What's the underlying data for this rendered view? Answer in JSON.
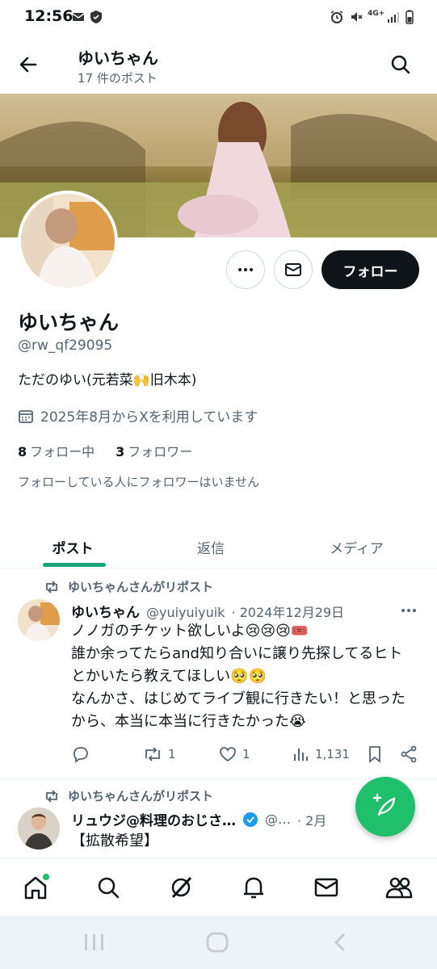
{
  "status_bar": {
    "time": "12:56",
    "network": "4G+",
    "icons": [
      "mail-icon",
      "shield-icon",
      "alarm-icon",
      "mute-icon",
      "signal-icon",
      "battery-icon"
    ]
  },
  "header": {
    "name": "ゆいちゃん",
    "post_count": "17 件のポスト"
  },
  "profile": {
    "name": "ゆいちゃん",
    "handle": "@rw_qf29095",
    "bio": "ただのゆい(元若菜🙌旧木本)",
    "joined": "2025年8月からXを利用しています",
    "following_count": "8",
    "following_label": "フォロー中",
    "followers_count": "3",
    "followers_label": "フォロワー",
    "note": "フォローしている人にフォロワーはいません",
    "follow_button": "フォロー"
  },
  "tabs": [
    {
      "label": "ポスト",
      "active": true
    },
    {
      "label": "返信",
      "active": false
    },
    {
      "label": "メディア",
      "active": false
    }
  ],
  "tweets": [
    {
      "repost_label": "ゆいちゃんさんがリポスト",
      "name": "ゆいちゃん",
      "handle": "@yuiyuiyuik",
      "date": "2024年12月29日",
      "lines": [
        "ノノガのチケット欲しいよ😢😢😢🎟️",
        "誰か余ってたらand知り合いに譲り先探してるヒト",
        "とかいたら教えてほしい🥺🥺",
        "なんかさ、はじめてライブ観に行きたい！と思った",
        "から、本当に本当に行きたかった😭"
      ],
      "reposts": "1",
      "likes": "1",
      "views": "1,131"
    },
    {
      "repost_label": "ゆいちゃんさんがリポスト",
      "name": "リュウジ@料理のおじさ…",
      "handle": "@…",
      "date": "· 2月",
      "first_line": "【拡散希望】"
    }
  ],
  "colors": {
    "accent": "#1aa37a",
    "fab": "#1fbf6b",
    "text_secondary": "#536471",
    "verified": "#1d9bf0"
  }
}
